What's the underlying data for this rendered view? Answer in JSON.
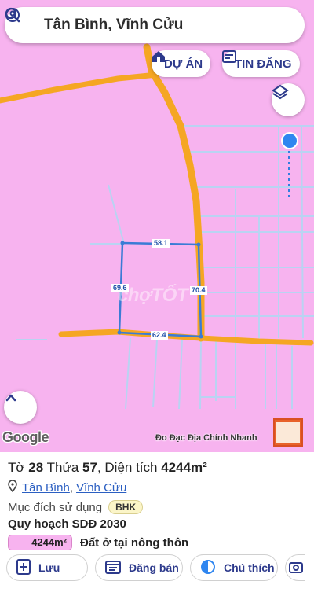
{
  "search": {
    "title": "Tân Bình, Vĩnh Cửu"
  },
  "top_buttons": {
    "projects": "DỰ ÁN",
    "listings": "TIN ĐĂNG"
  },
  "parcel_edges": {
    "top": "58.1",
    "left": "69.6",
    "right": "70.4",
    "bottom": "62.4"
  },
  "map": {
    "google_logo": "Google",
    "credit": "Đo Đạc Địa Chính Nhanh",
    "watermark": "chợTỐT",
    "base_color": "#f7b3ef",
    "road_color": "#f5a623",
    "parcel_color": "#3a7bd5"
  },
  "info": {
    "sheet_prefix": "Tờ ",
    "sheet": "28",
    "parcel_prefix": " Thửa ",
    "parcel": "57",
    "area_prefix": ", Diện tích ",
    "area": "4244m²",
    "ward": "Tân Bình",
    "district": "Vĩnh Cửu",
    "purpose_label": "Mục đích sử dụng",
    "purpose_code": "BHK",
    "plan_title": "Quy hoạch SDĐ 2030",
    "plan_area": "4244m²",
    "plan_desc": "Đất ở tại nông thôn"
  },
  "actions": {
    "save": "Lưu",
    "post": "Đăng bán",
    "legend": "Chú thích"
  }
}
